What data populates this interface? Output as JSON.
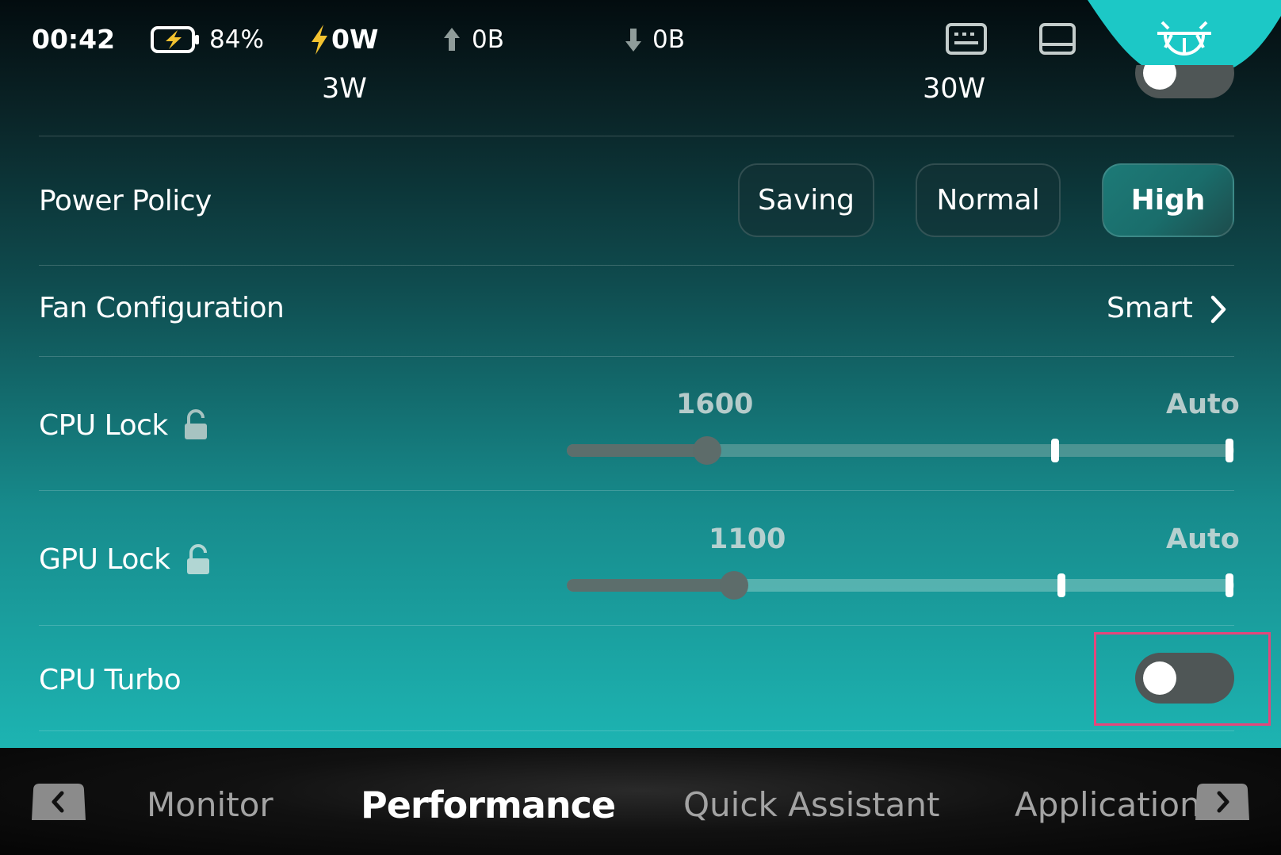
{
  "status_bar": {
    "time": "00:42",
    "battery_percent": "84%",
    "power_draw": "0W",
    "upload": "0B",
    "download": "0B"
  },
  "tdp_slider": {
    "min_label": "3W",
    "max_label": "30W"
  },
  "power_policy": {
    "label": "Power Policy",
    "options": [
      "Saving",
      "Normal",
      "High"
    ],
    "selected": "High"
  },
  "fan_configuration": {
    "label": "Fan Configuration",
    "value": "Smart"
  },
  "cpu_lock": {
    "label": "CPU Lock",
    "value": "1600",
    "max_label": "Auto",
    "level": 0.21
  },
  "gpu_lock": {
    "label": "GPU Lock",
    "value": "1100",
    "max_label": "Auto",
    "level": 0.25
  },
  "cpu_turbo": {
    "label": "CPU Turbo",
    "enabled": false
  },
  "bottom_nav": {
    "tabs": [
      "Monitor",
      "Performance",
      "Quick Assistant",
      "Application"
    ],
    "active": "Performance"
  },
  "colors": {
    "accent": "#1cc8c6",
    "highlight": "#e5467b",
    "charge_bolt": "#f2c230"
  },
  "icons": [
    "battery-charging-icon",
    "bolt-icon",
    "upload-arrow-icon",
    "download-arrow-icon",
    "keyboard-icon",
    "tablet-icon",
    "brightness-icon",
    "chevron-right-icon",
    "unlock-icon",
    "chevron-left-icon"
  ]
}
